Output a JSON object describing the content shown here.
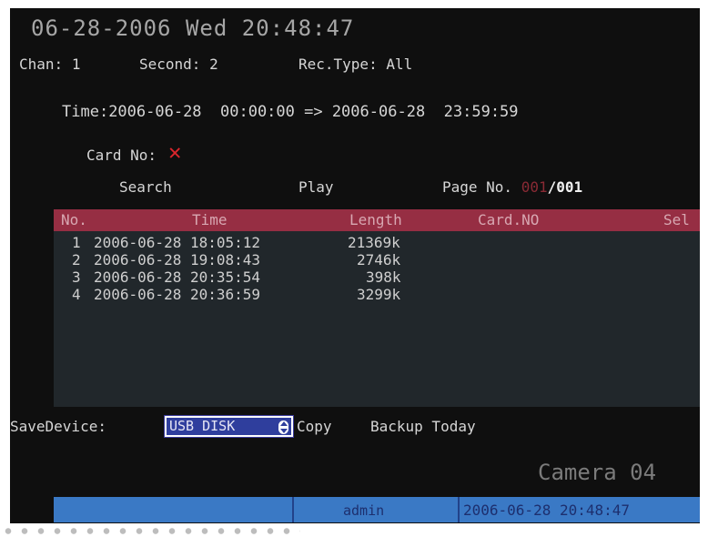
{
  "osd": {
    "date": "06-28-2006",
    "weekday": "Wed",
    "clock": "20:48:47"
  },
  "filters": {
    "chan_label": "Chan:",
    "chan_value": "1",
    "second_label": "Second:",
    "second_value": "2",
    "rectype_label": "Rec.Type:",
    "rectype_value": "All",
    "time_label": "Time:",
    "time_range": "2006-06-28  00:00:00 => 2006-06-28  23:59:59",
    "cardno_label": "Card No:"
  },
  "controls": {
    "search": "Search",
    "play": "Play",
    "page_label": "Page No.",
    "page_current": "001",
    "page_sep": "/",
    "page_total": "001"
  },
  "table": {
    "headers": [
      "No.",
      "Time",
      "Length",
      "Card.NO",
      "Sel"
    ],
    "rows": [
      {
        "no": "1",
        "time": "2006-06-28 18:05:12",
        "length": "21369k"
      },
      {
        "no": "2",
        "time": "2006-06-28 19:08:43",
        "length": "2746k"
      },
      {
        "no": "3",
        "time": "2006-06-28 20:35:54",
        "length": "398k"
      },
      {
        "no": "4",
        "time": "2006-06-28 20:36:59",
        "length": "3299k"
      }
    ]
  },
  "save_device": {
    "label": "SaveDevice:",
    "value": "USB DISK",
    "copy": "Copy",
    "backup_today": "Backup Today"
  },
  "camera_label": "Camera 04",
  "status": {
    "user": "admin",
    "datetime": "2006-06-28 20:48:47"
  },
  "colors": {
    "header_bar": "#962e43",
    "status_bar": "#3a79c5",
    "selected_field": "#2f3e9d",
    "invalid_mark": "#d9262c"
  },
  "icons": {
    "card_no_status": "x-mark-icon",
    "save_device_spinner": "spinner-updown-icon"
  }
}
